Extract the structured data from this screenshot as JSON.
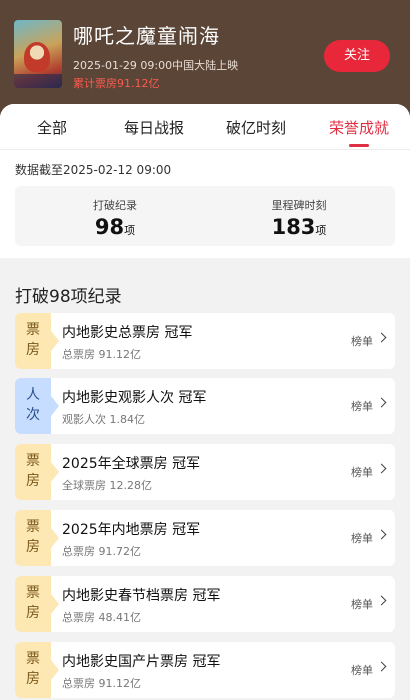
{
  "movie": {
    "title": "哪吒之魔童闹海",
    "release": "2025-01-29 09:00中国大陆上映",
    "box_office": "累计票房91.12亿",
    "follow_label": "关注"
  },
  "tabs": [
    {
      "label": "全部"
    },
    {
      "label": "每日战报"
    },
    {
      "label": "破亿时刻"
    },
    {
      "label": "荣誉成就"
    }
  ],
  "stats": {
    "as_of": "数据截至2025-02-12  09:00",
    "records_label": "打破纪录",
    "records_value": "98",
    "records_unit": "项",
    "milestones_label": "里程碑时刻",
    "milestones_value": "183",
    "milestones_unit": "项"
  },
  "section_title": "打破98项纪录",
  "records": [
    {
      "tag": "票\n房",
      "tag_type": "box",
      "title": "内地影史总票房  冠军",
      "sub": "总票房 91.12亿",
      "link": "榜单"
    },
    {
      "tag": "人\n次",
      "tag_type": "people",
      "title": "内地影史观影人次  冠军",
      "sub": "观影人次 1.84亿",
      "link": "榜单"
    },
    {
      "tag": "票\n房",
      "tag_type": "box",
      "title": "2025年全球票房  冠军",
      "sub": "全球票房 12.28亿",
      "link": "榜单"
    },
    {
      "tag": "票\n房",
      "tag_type": "box",
      "title": "2025年内地票房  冠军",
      "sub": "总票房 91.72亿",
      "link": "榜单"
    },
    {
      "tag": "票\n房",
      "tag_type": "box",
      "title": "内地影史春节档票房  冠军",
      "sub": "总票房 48.41亿",
      "link": "榜单"
    },
    {
      "tag": "票\n房",
      "tag_type": "box",
      "title": "内地影史国产片票房  冠军",
      "sub": "总票房 91.12亿",
      "link": "榜单"
    }
  ],
  "colors": {
    "accent": "#e02f43",
    "header_bg": "#5a4537",
    "box_tag": "#fde7b2",
    "people_tag": "#c6ddff"
  }
}
